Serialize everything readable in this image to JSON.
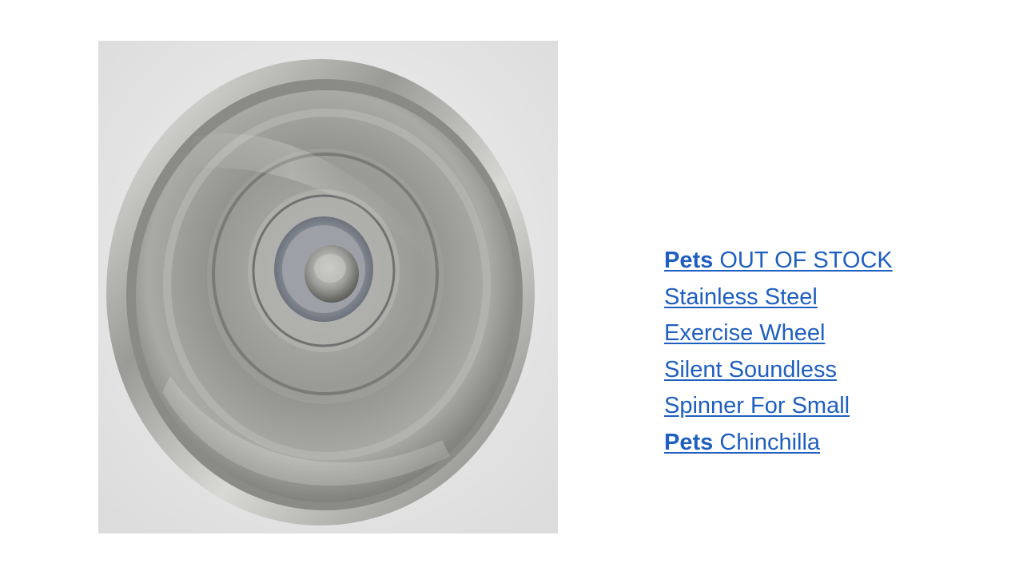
{
  "slide": {
    "image_subject": "stainless steel exercise wheel"
  },
  "caption": {
    "lines": [
      {
        "bold": "Pets",
        "text": " OUT OF STOCK"
      },
      {
        "bold": "",
        "text": "Stainless Steel"
      },
      {
        "bold": "",
        "text": "Exercise Wheel"
      },
      {
        "bold": "",
        "text": "Silent Soundless"
      },
      {
        "bold": "",
        "text": "Spinner For Small"
      },
      {
        "bold": "Pets",
        "text": " Chinchilla"
      }
    ]
  },
  "colors": {
    "link": "#1f5fbf",
    "background": "#ffffff",
    "photo_background": "#e9e9e9"
  }
}
